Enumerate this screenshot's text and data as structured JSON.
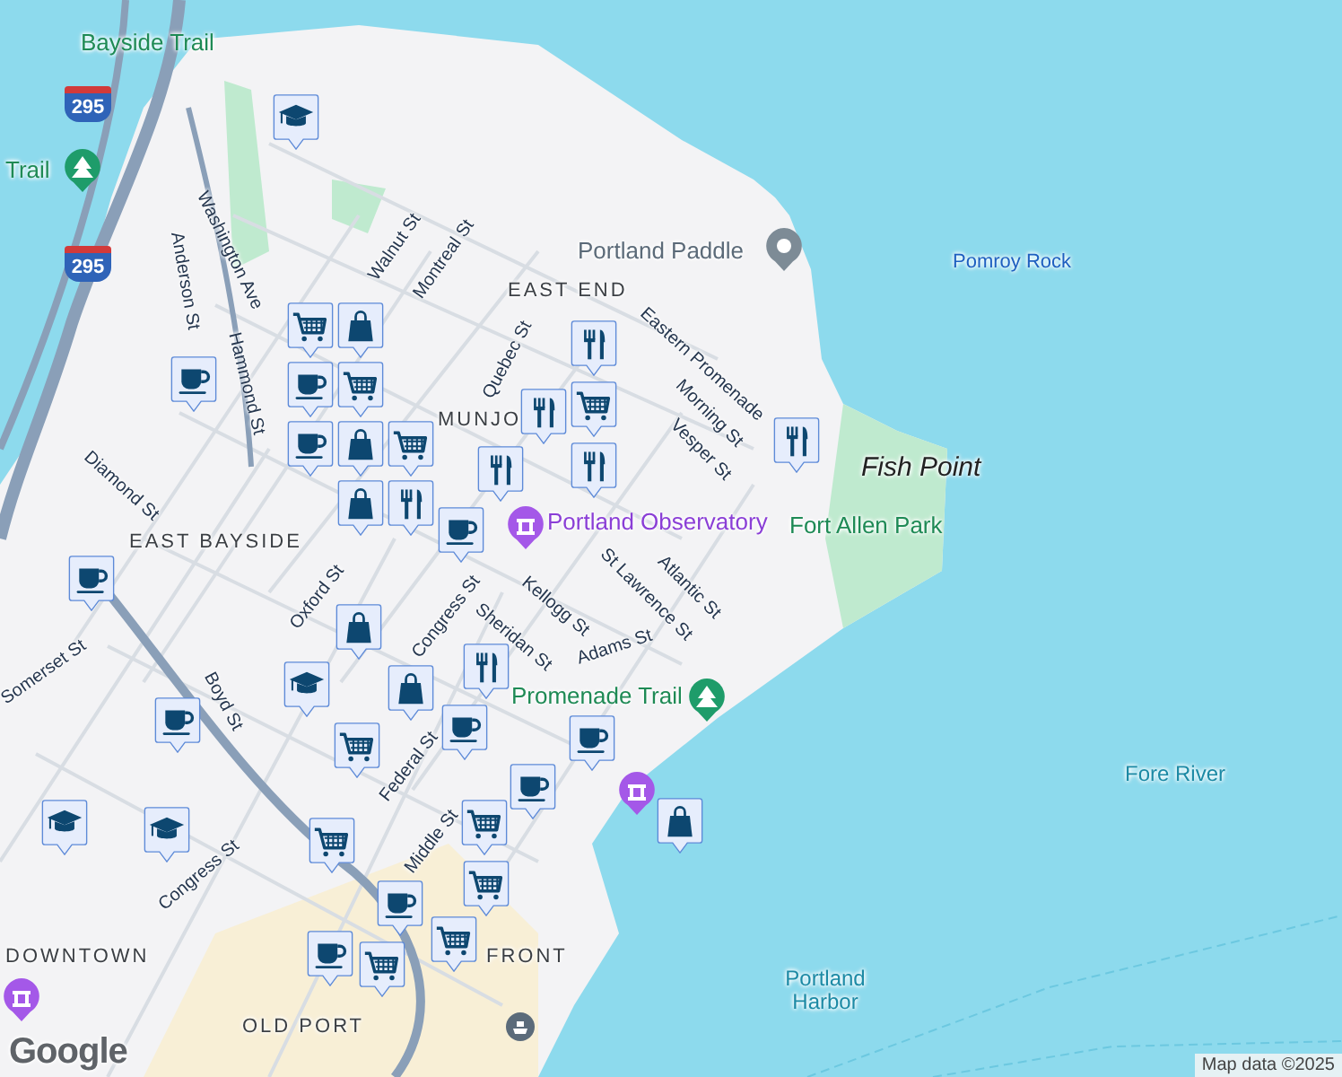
{
  "labels": [
    {
      "kind": "park",
      "text": "Bayside Trail"
    },
    {
      "kind": "park",
      "text": "Trail"
    },
    {
      "kind": "street",
      "text": "Washington Ave"
    },
    {
      "kind": "street",
      "text": "Anderson St"
    },
    {
      "kind": "place",
      "text": "Portland Paddle"
    },
    {
      "kind": "rock",
      "text": "Pomroy Rock"
    },
    {
      "kind": "street",
      "text": "Walnut St"
    },
    {
      "kind": "street",
      "text": "Montreal St"
    },
    {
      "kind": "area",
      "text": "EAST END"
    },
    {
      "kind": "street",
      "text": "Eastern Promenade"
    },
    {
      "kind": "street",
      "text": "Hammond St"
    },
    {
      "kind": "street",
      "text": "Quebec St"
    },
    {
      "kind": "street",
      "text": "Morning St"
    },
    {
      "kind": "area",
      "text": "MUNJO"
    },
    {
      "kind": "street",
      "text": "Vesper St"
    },
    {
      "kind": "street",
      "text": "Diamond St"
    },
    {
      "kind": "point",
      "text": "Fish Point"
    },
    {
      "kind": "poi",
      "text": "Portland Observatory"
    },
    {
      "kind": "park",
      "text": "Fort Allen Park"
    },
    {
      "kind": "area",
      "text": "EAST BAYSIDE"
    },
    {
      "kind": "street",
      "text": "Atlantic St"
    },
    {
      "kind": "street",
      "text": "St Lawrence St"
    },
    {
      "kind": "street",
      "text": "Kellogg St"
    },
    {
      "kind": "street",
      "text": "Sheridan St"
    },
    {
      "kind": "street",
      "text": "Oxford St"
    },
    {
      "kind": "street",
      "text": "Congress St"
    },
    {
      "kind": "street",
      "text": "Adams St"
    },
    {
      "kind": "street",
      "text": "Boyd St"
    },
    {
      "kind": "park",
      "text": "Promenade Trail"
    },
    {
      "kind": "street",
      "text": "Somerset St"
    },
    {
      "kind": "water",
      "text": "Fore River"
    },
    {
      "kind": "street",
      "text": "Federal St"
    },
    {
      "kind": "street",
      "text": "Middle St"
    },
    {
      "kind": "street",
      "text": "Congress St"
    },
    {
      "kind": "area",
      "text": "DOWNTOWN"
    },
    {
      "kind": "area",
      "text": "FRONT"
    },
    {
      "kind": "water",
      "text": "Portland Harbor"
    },
    {
      "kind": "area",
      "text": "OLD PORT"
    }
  ],
  "shields": [
    "295",
    "295"
  ],
  "markers": [
    {
      "kind": "school"
    },
    {
      "kind": "cafe"
    },
    {
      "kind": "cart"
    },
    {
      "kind": "shop"
    },
    {
      "kind": "cafe"
    },
    {
      "kind": "cart"
    },
    {
      "kind": "cafe"
    },
    {
      "kind": "shop"
    },
    {
      "kind": "cart"
    },
    {
      "kind": "shop"
    },
    {
      "kind": "restaurant"
    },
    {
      "kind": "restaurant"
    },
    {
      "kind": "restaurant"
    },
    {
      "kind": "cart"
    },
    {
      "kind": "restaurant"
    },
    {
      "kind": "restaurant"
    },
    {
      "kind": "restaurant"
    },
    {
      "kind": "cafe"
    },
    {
      "kind": "shop"
    },
    {
      "kind": "cafe"
    },
    {
      "kind": "school"
    },
    {
      "kind": "shop"
    },
    {
      "kind": "restaurant"
    },
    {
      "kind": "cart"
    },
    {
      "kind": "cafe"
    },
    {
      "kind": "cafe"
    },
    {
      "kind": "cafe"
    },
    {
      "kind": "shop"
    },
    {
      "kind": "cafe"
    },
    {
      "kind": "school"
    },
    {
      "kind": "school"
    },
    {
      "kind": "cart"
    },
    {
      "kind": "cart"
    },
    {
      "kind": "cart"
    },
    {
      "kind": "cafe"
    },
    {
      "kind": "cart"
    },
    {
      "kind": "cart"
    },
    {
      "kind": "cafe"
    }
  ],
  "logo": "Google",
  "attribution": "Map data ©2025"
}
